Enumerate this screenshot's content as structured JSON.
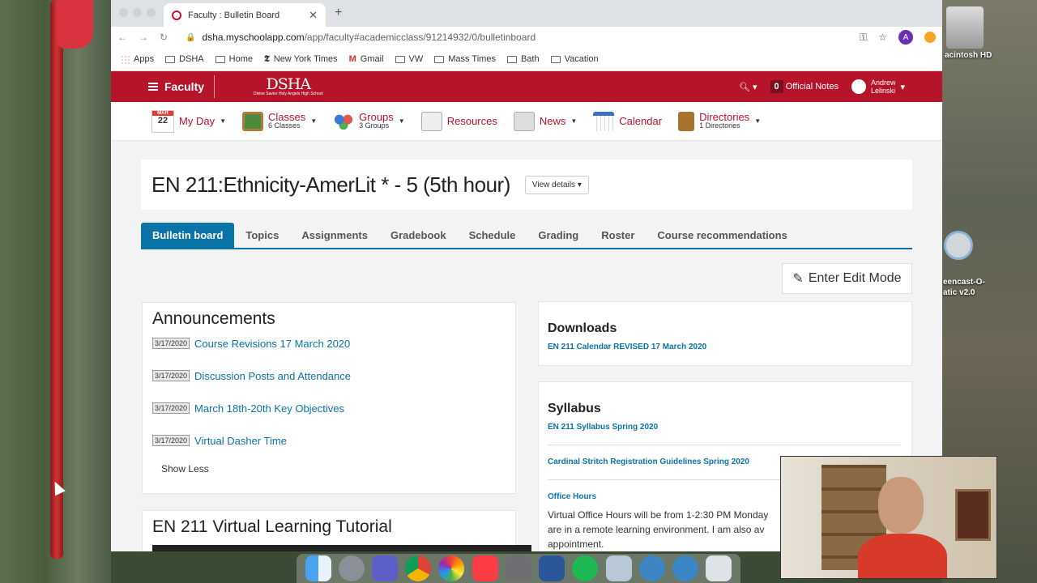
{
  "desktop": {
    "hd_label": "acintosh HD",
    "app_label": "eencast-O-\natic v2.0"
  },
  "browser": {
    "tab_title": "Faculty : Bulletin Board",
    "url_domain": "dsha.myschoolapp.com",
    "url_path": "/app/faculty#academicclass/91214932/0/bulletinboard",
    "avatar_letter": "A",
    "bookmarks": [
      "Apps",
      "DSHA",
      "Home",
      "New York Times",
      "Gmail",
      "VW",
      "Mass Times",
      "Bath",
      "Vacation"
    ]
  },
  "header": {
    "menu_label": "Faculty",
    "logo_big": "DSHA",
    "logo_small": "Divine Savior Holy Angels High School",
    "notes_count": "0",
    "notes_label": "Official Notes",
    "user_first": "Andrew",
    "user_last": "Lelinski"
  },
  "nav": {
    "calendar_month": "MAR",
    "calendar_day": "22",
    "my_day": "My Day",
    "classes": "Classes",
    "classes_sub": "6 Classes",
    "groups": "Groups",
    "groups_sub": "3 Groups",
    "resources": "Resources",
    "news": "News",
    "calendar": "Calendar",
    "directories": "Directories",
    "directories_sub": "1 Directories"
  },
  "page": {
    "title": "EN 211:Ethnicity-AmerLit * - 5 (5th hour)",
    "view_details": "View details ▾",
    "tabs": [
      "Bulletin board",
      "Topics",
      "Assignments",
      "Gradebook",
      "Schedule",
      "Grading",
      "Roster",
      "Course recommendations"
    ],
    "edit_mode": "Enter Edit Mode"
  },
  "announcements": {
    "heading": "Announcements",
    "items": [
      {
        "date": "3/17/2020",
        "title": "Course Revisions 17 March 2020"
      },
      {
        "date": "3/17/2020",
        "title": "Discussion Posts and Attendance"
      },
      {
        "date": "3/17/2020",
        "title": "March 18th-20th Key Objectives"
      },
      {
        "date": "3/17/2020",
        "title": "Virtual Dasher Time"
      }
    ],
    "show_less": "Show Less"
  },
  "tutorial": {
    "heading": "EN 211 Virtual Learning Tutorial"
  },
  "downloads": {
    "heading": "Downloads",
    "link": "EN 211 Calendar REVISED 17 March 2020"
  },
  "syllabus": {
    "heading": "Syllabus",
    "link1": "EN 211 Syllabus Spring 2020",
    "link2": "Cardinal Stritch Registration Guidelines Spring 2020",
    "office_hours": "Office Hours",
    "office_text": "Virtual Office Hours will be from 1-2:30 PM Monday are in a remote learning environment.   I am also av appointment."
  }
}
